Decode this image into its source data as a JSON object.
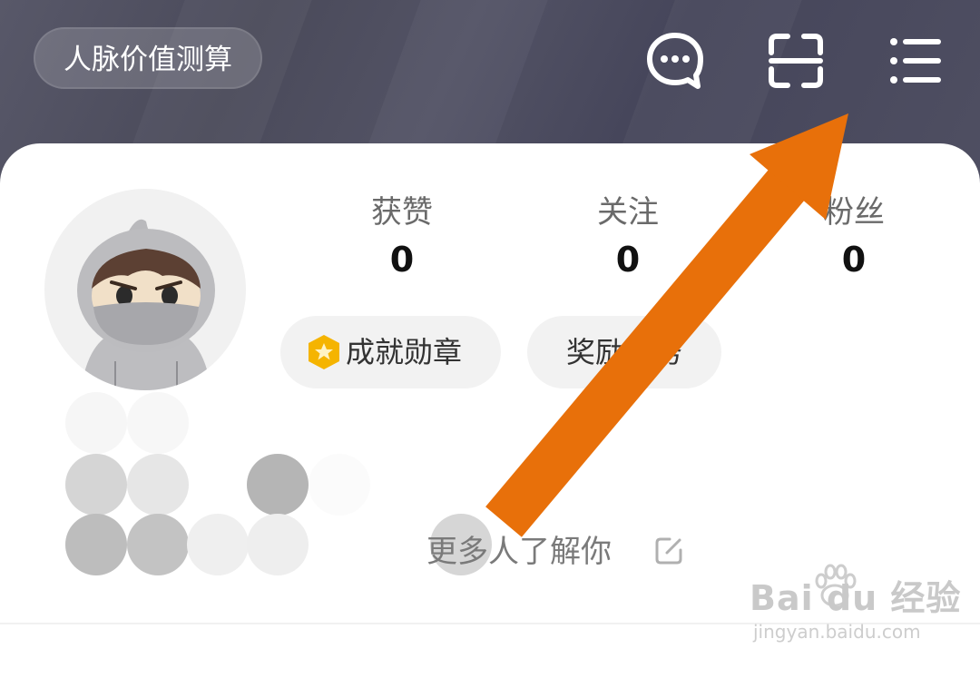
{
  "header": {
    "value_button_label": "人脉价值测算",
    "icons": [
      "message-icon",
      "scan-icon",
      "menu-icon"
    ]
  },
  "profile": {
    "stats": [
      {
        "label": "获赞",
        "value": "0"
      },
      {
        "label": "关注",
        "value": "0"
      },
      {
        "label": "粉丝",
        "value": "0"
      }
    ],
    "chips": {
      "achievements": "成就勋章",
      "rewards": "奖励任务"
    },
    "bio_prompt": "更多人了解你"
  },
  "watermark": {
    "logo": "Bai du 经验",
    "url": "jingyan.baidu.com"
  },
  "colors": {
    "banner": "#4c4c5e",
    "arrow": "#e8700a",
    "medal": "#f5b400"
  }
}
